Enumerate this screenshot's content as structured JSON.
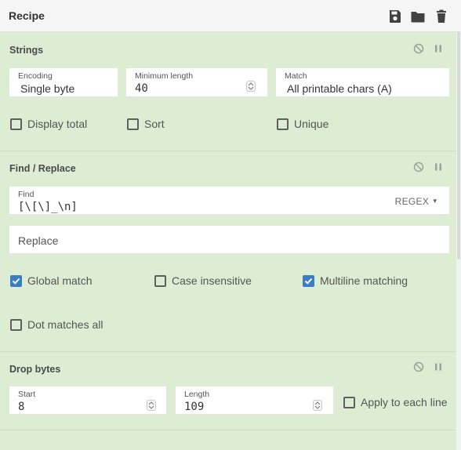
{
  "header": {
    "title": "Recipe",
    "icons": [
      "save-icon",
      "folder-icon",
      "trash-icon"
    ]
  },
  "colors": {
    "panel_bg": "#dcedd4",
    "accent": "#3a7dc0"
  },
  "strings_op": {
    "title": "Strings",
    "encoding": {
      "label": "Encoding",
      "value": "Single byte"
    },
    "min_length": {
      "label": "Minimum length",
      "value": "40"
    },
    "match": {
      "label": "Match",
      "value": "All printable chars (A)"
    },
    "display_total": {
      "label": "Display total",
      "checked": false
    },
    "sort": {
      "label": "Sort",
      "checked": false
    },
    "unique": {
      "label": "Unique",
      "checked": false
    }
  },
  "find_replace_op": {
    "title": "Find / Replace",
    "find": {
      "label": "Find",
      "value": "[\\[\\]_\\n]"
    },
    "regex_button": "REGEX",
    "replace": {
      "placeholder": "Replace"
    },
    "global_match": {
      "label": "Global match",
      "checked": true
    },
    "case_insensitive": {
      "label": "Case insensitive",
      "checked": false
    },
    "multiline": {
      "label": "Multiline matching",
      "checked": true
    },
    "dot_matches_all": {
      "label": "Dot matches all",
      "checked": false
    }
  },
  "drop_bytes_op": {
    "title": "Drop bytes",
    "start": {
      "label": "Start",
      "value": "8"
    },
    "length": {
      "label": "Length",
      "value": "109"
    },
    "apply_each_line": {
      "label": "Apply to each line",
      "checked": false
    }
  }
}
